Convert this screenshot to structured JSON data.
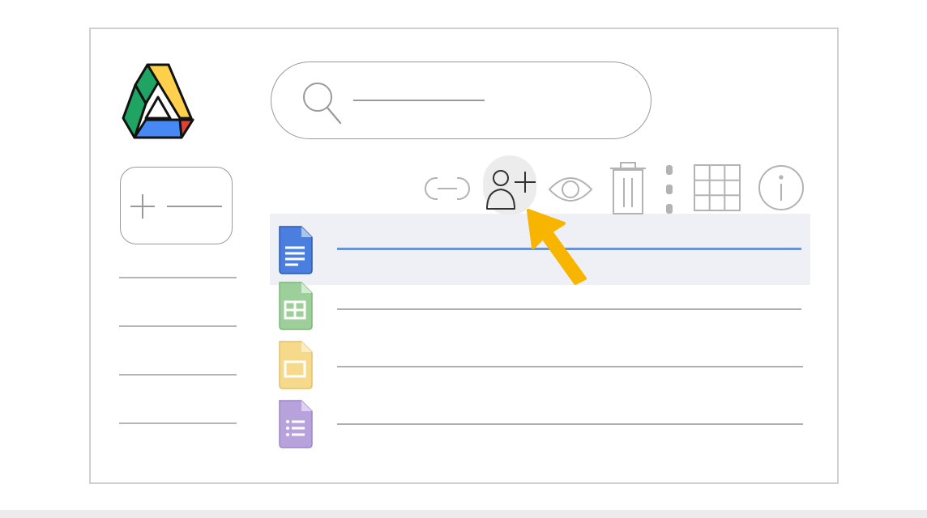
{
  "app": {
    "name": "Google Drive"
  },
  "search": {
    "placeholder": ""
  },
  "new_button": {
    "label": ""
  },
  "toolbar": {
    "icons": [
      "link-icon",
      "share-user-add-icon",
      "preview-eye-icon",
      "trash-icon",
      "more-vertical-icon",
      "grid-view-icon",
      "info-icon"
    ],
    "active": "share-user-add-icon"
  },
  "files": [
    {
      "type": "docs",
      "color": "#4a7fe0",
      "selected": true
    },
    {
      "type": "sheets",
      "color": "#9ccf9a",
      "selected": false
    },
    {
      "type": "slides",
      "color": "#f6d98a",
      "selected": false
    },
    {
      "type": "forms",
      "color": "#b8a2dc",
      "selected": false
    }
  ],
  "colors": {
    "cursor": "#f7b500",
    "selection": "#eef0f5",
    "selected_line": "#6b93d3",
    "drive_green": "#1fa463",
    "drive_yellow": "#ffd04b",
    "drive_blue": "#4688f4",
    "drive_red": "#dc4437"
  }
}
